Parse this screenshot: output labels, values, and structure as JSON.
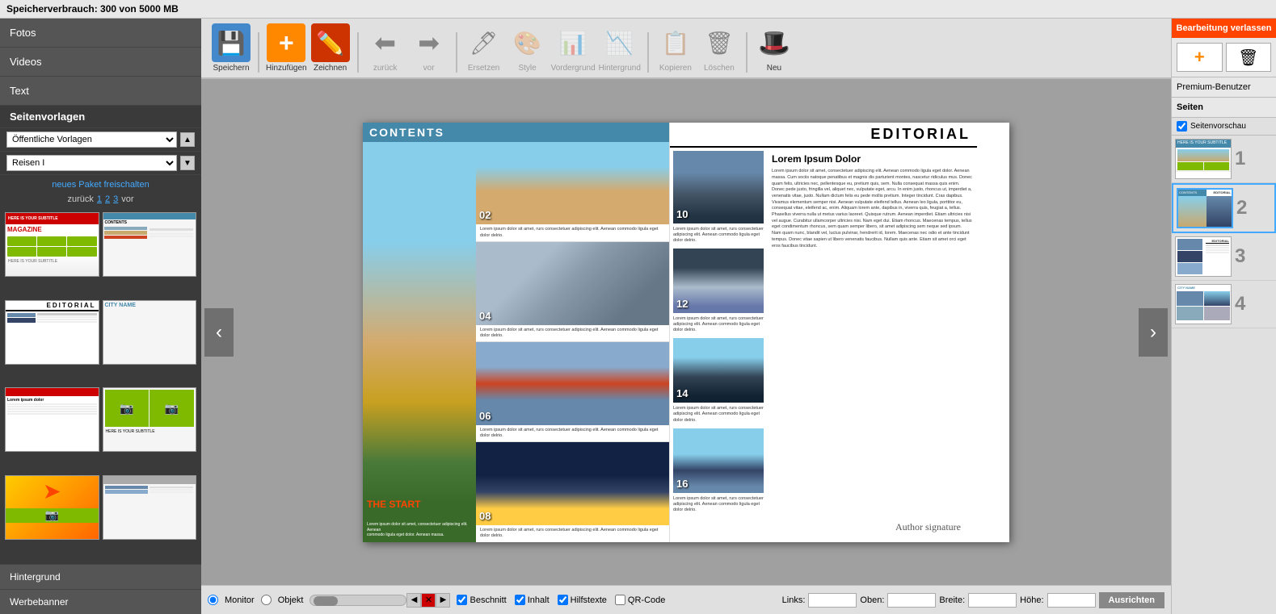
{
  "topbar": {
    "storage_label": "Speicherverbrauch: 300 von 5000 MB"
  },
  "left_sidebar": {
    "buttons": [
      {
        "id": "fotos",
        "label": "Fotos"
      },
      {
        "id": "videos",
        "label": "Videos"
      },
      {
        "id": "text",
        "label": "Text"
      }
    ],
    "section_label": "Seitenvorlagen",
    "dropdown1_label": "Öffentliche Vorlagen",
    "dropdown2_label": "Reisen I",
    "new_package_link": "neues Paket freischalten",
    "nav": {
      "back": "zurück",
      "pages": [
        "1",
        "2",
        "3"
      ],
      "forward": "vor"
    },
    "bottom_buttons": [
      {
        "id": "hintergrund",
        "label": "Hintergrund"
      },
      {
        "id": "werbebanner",
        "label": "Werbebanner"
      }
    ]
  },
  "toolbar": {
    "tools": [
      {
        "id": "speichern",
        "label": "Speichern",
        "icon": "💾",
        "color": "blue",
        "disabled": false
      },
      {
        "id": "hinzufuegen",
        "label": "Hinzufügen",
        "icon": "➕",
        "color": "orange",
        "disabled": false
      },
      {
        "id": "zeichnen",
        "label": "Zeichnen",
        "icon": "✏️",
        "color": "red",
        "disabled": false
      },
      {
        "id": "zurueck",
        "label": "zurück",
        "icon": "⬅️",
        "color": "",
        "disabled": true
      },
      {
        "id": "vor",
        "label": "vor",
        "icon": "➡️",
        "color": "",
        "disabled": true
      },
      {
        "id": "ersetzen",
        "label": "Ersetzen",
        "icon": "🖊️",
        "color": "",
        "disabled": true
      },
      {
        "id": "style",
        "label": "Style",
        "icon": "🎨",
        "color": "",
        "disabled": true
      },
      {
        "id": "vordergrund",
        "label": "Vordergrund",
        "icon": "⬆️",
        "color": "",
        "disabled": true
      },
      {
        "id": "hintergrund",
        "label": "Hintergrund",
        "icon": "⬇️",
        "color": "",
        "disabled": true
      },
      {
        "id": "kopieren",
        "label": "Kopieren",
        "icon": "📋",
        "color": "",
        "disabled": true
      },
      {
        "id": "loeschen",
        "label": "Löschen",
        "icon": "🗑️",
        "color": "",
        "disabled": true
      },
      {
        "id": "neu",
        "label": "Neu",
        "icon": "🎩",
        "color": "",
        "disabled": false
      }
    ]
  },
  "canvas": {
    "left_page": {
      "header": "CONTENTS",
      "entries": [
        {
          "number": "02",
          "text": "Lorem ipsum dolor sit amet, rurs consectetuer adipiscing elit. Aenean commodo ligula eget dolor delrio."
        },
        {
          "number": "04",
          "text": "Lorem ipsum dolor sit amet, rurs consectetuer adipiscing elit. Aenean commodo ligula eget dolor delrio."
        },
        {
          "number": "06",
          "text": "Lorem ipsum dolor sit amet, rurs consectetuer adipiscing elit. Aenean commodo ligula eget dolor delrio."
        },
        {
          "number": "08",
          "text": "Lorem ipsum dolor sit amet, rurs consectetuer adipiscing elit. Aenean commodo ligula eget dolor delrio."
        }
      ],
      "the_start": "THE START"
    },
    "right_page": {
      "header": "EDITORIAL",
      "entries": [
        {
          "number": "10",
          "text": "Lorem ipsum dolor sit amet, rurs consectetuer adipiscing elit. Aenean commodo ligula eget dolor delrio."
        },
        {
          "number": "12",
          "text": "Lorem ipsum dolor sit amet, rurs consectetuer adipiscing elit. Aenean commodo ligula eget dolor delrio."
        },
        {
          "number": "14",
          "text": "Lorem ipsum dolor sit amet, rurs consectetuer adipiscing elit. Aenean commodo ligula eget dolor delrio."
        },
        {
          "number": "16",
          "text": "Lorem ipsum dolor sit amet, rurs consectetuer adipiscing elit. Aenean commodo ligula eget dolor delrio."
        }
      ],
      "title": "Lorem Ipsum Dolor",
      "body_text": "Lorem ipsum dolor sit amet, consectetuer adipiscing elit. Aenean commodo ligula eget dolor. Aenean massa. Cum sociis natoque penatibus et magnis dis parturient montes, nascetur ridiculus mus. Donec quam felis, ultricies nec, pellentesque eu, pretium quis, sem. Nulla consequat massa quis enim. Donec pede justo, fringilla vel, aliquet nec, vulputate eget, arcu. In enim justo, rhoncus ut, imperdiet a, venenatis vitae, justo.\n\nNullam dictum felis eu pede mollis pretium. Integer tincidunt. Cras dapibus. Vivamus elementum semper nisi. Aenean vulputate eleifend tellus. Aenean leo ligula, porttitor eu, consequat vitae, eleifend ac, enim. Aliquam lorem ante, dapibus in, viverra quis, feugiat a, tellus. Phasellus viverra nulla ut metus varius laoreet. Quisque rutrum.\n\nAenean imperdiet. Etiam ultricies nisi vel augue. Curabitur ullamcorper ultricies nisi. Nam eget dui. Etiam rhoncus. Maecenas tempus, tellus eget condimentum rhoncus, sem quam semper libero, sit amet adipiscing sem neque sed ipsum. Nam quam nunc, blandit vel, luctus pulvinar, hendrerit id, lorem. Maecenas nec odio et ante tincidunt tempus. Donec vitae sapien ut libero venenatis faucibus. Nullam quis ante. Etiam sit amet orci eget eros faucibus tincidunt.",
      "signature": "Author signature"
    }
  },
  "bottom_toolbar": {
    "radio_monitor": "Monitor",
    "radio_objekt": "Objekt",
    "checkboxes": [
      {
        "id": "beschnitt",
        "label": "Beschnitt",
        "checked": true
      },
      {
        "id": "inhalt",
        "label": "Inhalt",
        "checked": true
      },
      {
        "id": "hilfstexte",
        "label": "Hilfstexte",
        "checked": true
      },
      {
        "id": "qr_code",
        "label": "QR-Code",
        "checked": false
      }
    ],
    "links_label": "Links:",
    "oben_label": "Oben:",
    "breite_label": "Breite:",
    "hoehe_label": "Höhe:",
    "ausrichten_btn": "Ausrichten"
  },
  "right_panel": {
    "bearbeitung_btn": "Bearbeitung verlassen",
    "premium_btn": "Premium-Benutzer",
    "seiten_btn": "Seiten",
    "preview_label": "Seitenvorschau",
    "add_icon": "➕",
    "delete_icon": "🗑️",
    "pages": [
      {
        "num": "1",
        "type": "cover"
      },
      {
        "num": "2",
        "type": "contents",
        "active": true
      },
      {
        "num": "3",
        "type": "editorial"
      },
      {
        "num": "4",
        "type": "citypage"
      }
    ]
  }
}
